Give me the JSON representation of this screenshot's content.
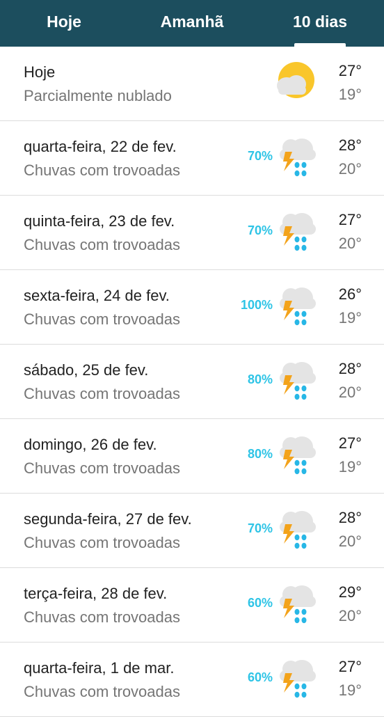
{
  "tabs": [
    {
      "label": "Hoje",
      "active": false
    },
    {
      "label": "Amanhã",
      "active": false
    },
    {
      "label": "10 dias",
      "active": true
    }
  ],
  "colors": {
    "header_bg": "#1c4e5e",
    "precip": "#2ec4e6",
    "sun": "#f9c62b",
    "cloud": "#e4e4e4",
    "bolt": "#f3a31b",
    "rain": "#27b7e6"
  },
  "days": [
    {
      "day": "Hoje",
      "condition": "Parcialmente nublado",
      "precip": "",
      "icon": "partly-cloudy-icon",
      "high": "27°",
      "low": "19°"
    },
    {
      "day": "quarta-feira, 22 de fev.",
      "condition": "Chuvas com trovoadas",
      "precip": "70%",
      "icon": "thunderstorm-icon",
      "high": "28°",
      "low": "20°"
    },
    {
      "day": "quinta-feira, 23 de fev.",
      "condition": "Chuvas com trovoadas",
      "precip": "70%",
      "icon": "thunderstorm-icon",
      "high": "27°",
      "low": "20°"
    },
    {
      "day": "sexta-feira, 24 de fev.",
      "condition": "Chuvas com trovoadas",
      "precip": "100%",
      "icon": "thunderstorm-icon",
      "high": "26°",
      "low": "19°"
    },
    {
      "day": "sábado, 25 de fev.",
      "condition": "Chuvas com trovoadas",
      "precip": "80%",
      "icon": "thunderstorm-icon",
      "high": "28°",
      "low": "20°"
    },
    {
      "day": "domingo, 26 de fev.",
      "condition": "Chuvas com trovoadas",
      "precip": "80%",
      "icon": "thunderstorm-icon",
      "high": "27°",
      "low": "19°"
    },
    {
      "day": "segunda-feira, 27 de fev.",
      "condition": "Chuvas com trovoadas",
      "precip": "70%",
      "icon": "thunderstorm-icon",
      "high": "28°",
      "low": "20°"
    },
    {
      "day": "terça-feira, 28 de fev.",
      "condition": "Chuvas com trovoadas",
      "precip": "60%",
      "icon": "thunderstorm-icon",
      "high": "29°",
      "low": "20°"
    },
    {
      "day": "quarta-feira, 1 de mar.",
      "condition": "Chuvas com trovoadas",
      "precip": "60%",
      "icon": "thunderstorm-icon",
      "high": "27°",
      "low": "19°"
    }
  ]
}
